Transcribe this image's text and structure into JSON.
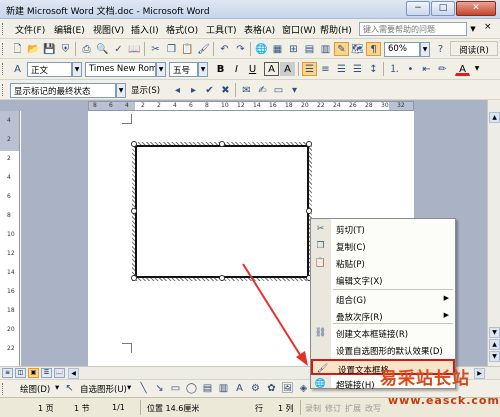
{
  "window": {
    "title": "新建 Microsoft Word 文档.doc - Microsoft Word",
    "minimize": "−",
    "maximize": "□",
    "close": "✕"
  },
  "menubar": {
    "items": [
      "文件(F)",
      "编辑(E)",
      "视图(V)",
      "插入(I)",
      "格式(O)",
      "工具(T)",
      "表格(A)",
      "窗口(W)",
      "帮助(H)"
    ],
    "help_placeholder": "键入需要帮助的问题",
    "doc_close": "×"
  },
  "toolbar_standard": {
    "zoom": "60%",
    "read_button": "阅读(R)"
  },
  "toolbar_format": {
    "style": "正文",
    "font": "Times New Roman",
    "size": "五号",
    "bold": "B",
    "italic": "I",
    "underline": "U",
    "char_border": "A",
    "char_shading": "A",
    "font_color": "A"
  },
  "toolbar_review": {
    "display_mode": "显示标记的最终状态",
    "show_button": "显示(S)"
  },
  "ruler": {
    "numbers": [
      "8",
      "6",
      "4",
      "2",
      "2",
      "4",
      "6",
      "8",
      "10",
      "12",
      "14",
      "16",
      "18",
      "20",
      "22",
      "24",
      "26",
      "28",
      "30",
      "32"
    ]
  },
  "vruler": {
    "numbers": [
      "4",
      "2",
      "2",
      "4",
      "6",
      "8",
      "10",
      "12",
      "14",
      "16",
      "18",
      "20",
      "22"
    ]
  },
  "context_menu": {
    "items": [
      {
        "label": "剪切(T)",
        "icon": "scissors-icon",
        "glyph": "✂"
      },
      {
        "label": "复制(C)",
        "icon": "copy-icon",
        "glyph": "❐"
      },
      {
        "label": "粘贴(P)",
        "icon": "paste-icon",
        "glyph": "📋"
      },
      {
        "label": "编辑文字(X)",
        "icon": "",
        "glyph": ""
      },
      {
        "label": "组合(G)",
        "icon": "",
        "glyph": "",
        "submenu": true
      },
      {
        "label": "叠放次序(R)",
        "icon": "",
        "glyph": "",
        "submenu": true
      },
      {
        "label": "创建文本框链接(R)",
        "icon": "link-icon",
        "glyph": "⛓"
      },
      {
        "label": "设置自选图形的默认效果(D)",
        "icon": "",
        "glyph": ""
      },
      {
        "label": "设置文本框格",
        "icon": "format-textbox-icon",
        "glyph": "🖌"
      },
      {
        "label": "超链接(H)",
        "icon": "hyperlink-icon",
        "glyph": "🌐"
      }
    ],
    "highlighted_index": 8
  },
  "drawing_toolbar": {
    "draw": "绘图(D)",
    "autoshapes": "自选图形(U)"
  },
  "statusbar": {
    "page": "1 页",
    "section": "1 节",
    "page_of": "1/1",
    "position": "位置 14.6厘米",
    "line": "行",
    "col": "1 列",
    "rec": "录制",
    "trk": "修订",
    "ext": "扩展",
    "ovr": "改写"
  },
  "watermark": {
    "site_name": "易采站长站",
    "url": "www.easck.com"
  }
}
